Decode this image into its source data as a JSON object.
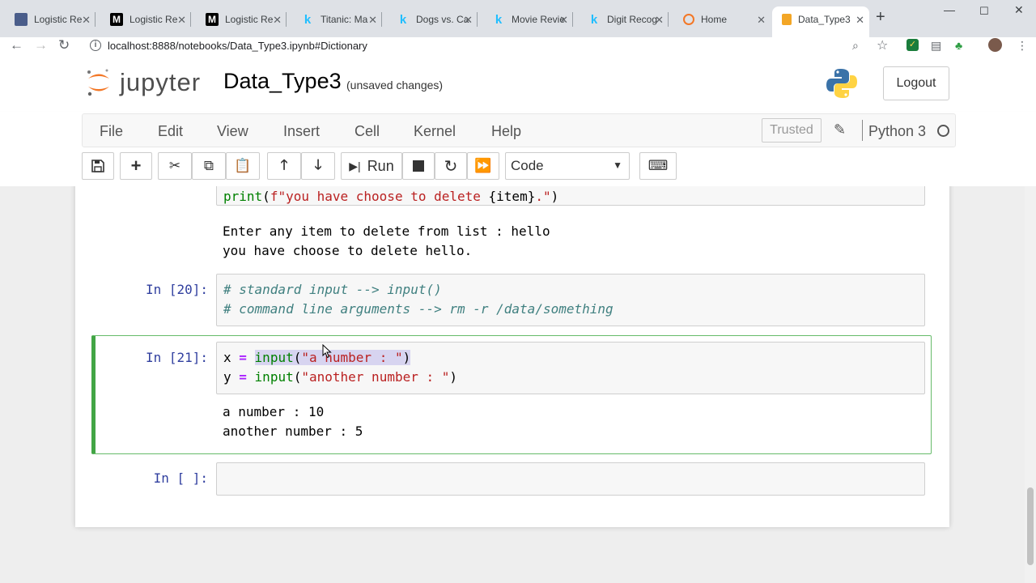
{
  "browser": {
    "tabs": [
      {
        "title": "Logistic Re",
        "favicon": "doc-icon",
        "color": "#4a5d8a"
      },
      {
        "title": "Logistic Re",
        "favicon": "medium-icon",
        "color": "#000000"
      },
      {
        "title": "Logistic Re",
        "favicon": "medium-icon",
        "color": "#000000"
      },
      {
        "title": "Titanic: Ma",
        "favicon": "kaggle-icon",
        "color": "#20beff"
      },
      {
        "title": "Dogs vs. Ca",
        "favicon": "kaggle-icon",
        "color": "#20beff"
      },
      {
        "title": "Movie Revie",
        "favicon": "kaggle-icon",
        "color": "#20beff"
      },
      {
        "title": "Digit Recog",
        "favicon": "kaggle-icon",
        "color": "#20beff"
      },
      {
        "title": "Home",
        "favicon": "jupyter-icon",
        "color": "#f37726"
      },
      {
        "title": "Data_Type3",
        "favicon": "notebook-icon",
        "color": "#f37726",
        "active": true
      }
    ],
    "new_tab": "+",
    "url": "localhost:8888/notebooks/Data_Type3.ipynb#Dictionary"
  },
  "header": {
    "logo_text": "jupyter",
    "notebook_name": "Data_Type3",
    "save_status": "(unsaved changes)",
    "logout_label": "Logout"
  },
  "menu": {
    "items": [
      "File",
      "Edit",
      "View",
      "Insert",
      "Cell",
      "Kernel",
      "Help"
    ],
    "trusted": "Trusted",
    "kernel_name": "Python 3"
  },
  "toolbar": {
    "run_label": "Run",
    "cell_type": "Code"
  },
  "cells": [
    {
      "prompt": "",
      "code": "print(f\"you have choose to delete {item}.\")",
      "output": [
        "Enter any item to delete from list : hello",
        "you have choose to delete hello."
      ]
    },
    {
      "prompt": "In [20]:",
      "code_lines": [
        "# standard input --> input()",
        "# command line arguments --> rm -r /data/something"
      ]
    },
    {
      "prompt": "In [21]:",
      "code_lines": [
        "x = input(\"a number : \")",
        "y = input(\"another number : \")"
      ],
      "output": [
        "a number : 10",
        "another number : 5"
      ],
      "selected": true
    },
    {
      "prompt": "In [ ]:",
      "code_lines": []
    }
  ]
}
